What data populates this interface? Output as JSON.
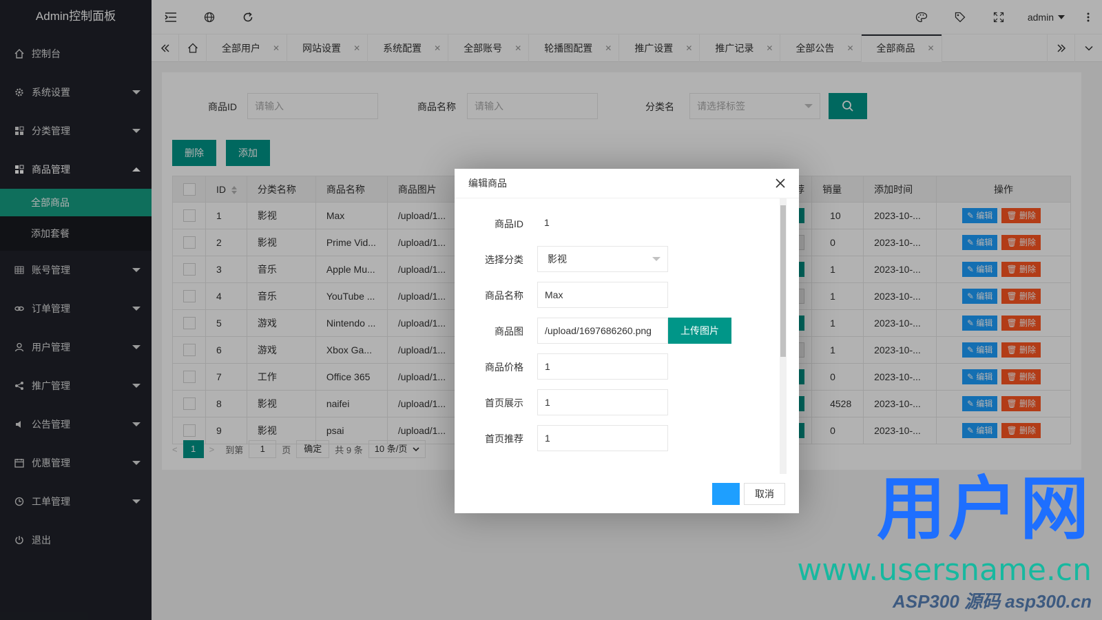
{
  "sidebar": {
    "logo": "Admin控制面板",
    "items": [
      {
        "label": "控制台",
        "icon": "home-icon"
      },
      {
        "label": "系统设置",
        "icon": "gear-icon"
      },
      {
        "label": "分类管理",
        "icon": "grid-icon"
      },
      {
        "label": "商品管理",
        "icon": "grid-icon"
      },
      {
        "label": "账号管理",
        "icon": "table-icon"
      },
      {
        "label": "订单管理",
        "icon": "link-icon"
      },
      {
        "label": "用户管理",
        "icon": "user-icon"
      },
      {
        "label": "推广管理",
        "icon": "share-icon"
      },
      {
        "label": "公告管理",
        "icon": "speaker-icon"
      },
      {
        "label": "优惠管理",
        "icon": "calendar-icon"
      },
      {
        "label": "工单管理",
        "icon": "clock-icon"
      },
      {
        "label": "退出",
        "icon": "power-icon"
      }
    ],
    "sub_items": [
      "全部商品",
      "添加套餐"
    ]
  },
  "header": {
    "user": "admin"
  },
  "tabs": [
    "全部用户",
    "网站设置",
    "系统配置",
    "全部账号",
    "轮播图配置",
    "推广设置",
    "推广记录",
    "全部公告",
    "全部商品"
  ],
  "filter": {
    "id_label": "商品ID",
    "id_placeholder": "请输入",
    "name_label": "商品名称",
    "name_placeholder": "请输入",
    "cat_label": "分类名",
    "cat_placeholder": "请选择标签"
  },
  "toolbar": {
    "delete_label": "删除",
    "add_label": "添加"
  },
  "table": {
    "headers": [
      "ID",
      "分类名称",
      "商品名称",
      "商品图片",
      "荐",
      "销量",
      "添加时间",
      "操作"
    ],
    "rows": [
      {
        "id": "1",
        "cat": "影视",
        "name": "Max",
        "img": "/upload/1...",
        "sales": "10",
        "time": "2023-10-..."
      },
      {
        "id": "2",
        "cat": "影视",
        "name": "Prime Vid...",
        "img": "/upload/1...",
        "sales": "0",
        "time": "2023-10-..."
      },
      {
        "id": "3",
        "cat": "音乐",
        "name": "Apple Mu...",
        "img": "/upload/1...",
        "sales": "1",
        "time": "2023-10-..."
      },
      {
        "id": "4",
        "cat": "音乐",
        "name": "YouTube ...",
        "img": "/upload/1...",
        "sales": "1",
        "time": "2023-10-..."
      },
      {
        "id": "5",
        "cat": "游戏",
        "name": "Nintendo ...",
        "img": "/upload/1...",
        "sales": "1",
        "time": "2023-10-..."
      },
      {
        "id": "6",
        "cat": "游戏",
        "name": "Xbox Ga...",
        "img": "/upload/1...",
        "sales": "1",
        "time": "2023-10-..."
      },
      {
        "id": "7",
        "cat": "工作",
        "name": "Office 365",
        "img": "/upload/1...",
        "sales": "0",
        "time": "2023-10-..."
      },
      {
        "id": "8",
        "cat": "影视",
        "name": "naifei",
        "img": "/upload/1...",
        "sales": "4528",
        "time": "2023-10-..."
      },
      {
        "id": "9",
        "cat": "影视",
        "name": "psai",
        "img": "/upload/1...",
        "sales": "0",
        "time": "2023-10-..."
      }
    ],
    "edit_label": "编辑",
    "delete_label": "删除"
  },
  "pager": {
    "current": "1",
    "goto_label": "到第",
    "goto_value": "1",
    "page_unit": "页",
    "confirm_label": "确定",
    "total": "共 9 条",
    "per_page": "10 条/页"
  },
  "modal": {
    "title": "编辑商品",
    "fields": {
      "id_label": "商品ID",
      "id_value": "1",
      "cat_label": "选择分类",
      "cat_value": "影视",
      "name_label": "商品名称",
      "name_value": "Max",
      "img_label": "商品图",
      "img_value": "/upload/1697686260.png",
      "upload_label": "上传图片",
      "price_label": "商品价格",
      "price_value": "1",
      "home_show_label": "首页展示",
      "home_show_value": "1",
      "home_rec_label": "首页推荐",
      "home_rec_value": "1"
    },
    "cancel_label": "取消"
  },
  "watermark": {
    "brand": "用户网",
    "url": "www.usersname.cn",
    "asp": "ASP300 源码 asp300.cn"
  },
  "colors": {
    "sidebar_bg": "#20222a",
    "accent": "#009688",
    "edit": "#1e9fff",
    "danger": "#ff5722"
  }
}
